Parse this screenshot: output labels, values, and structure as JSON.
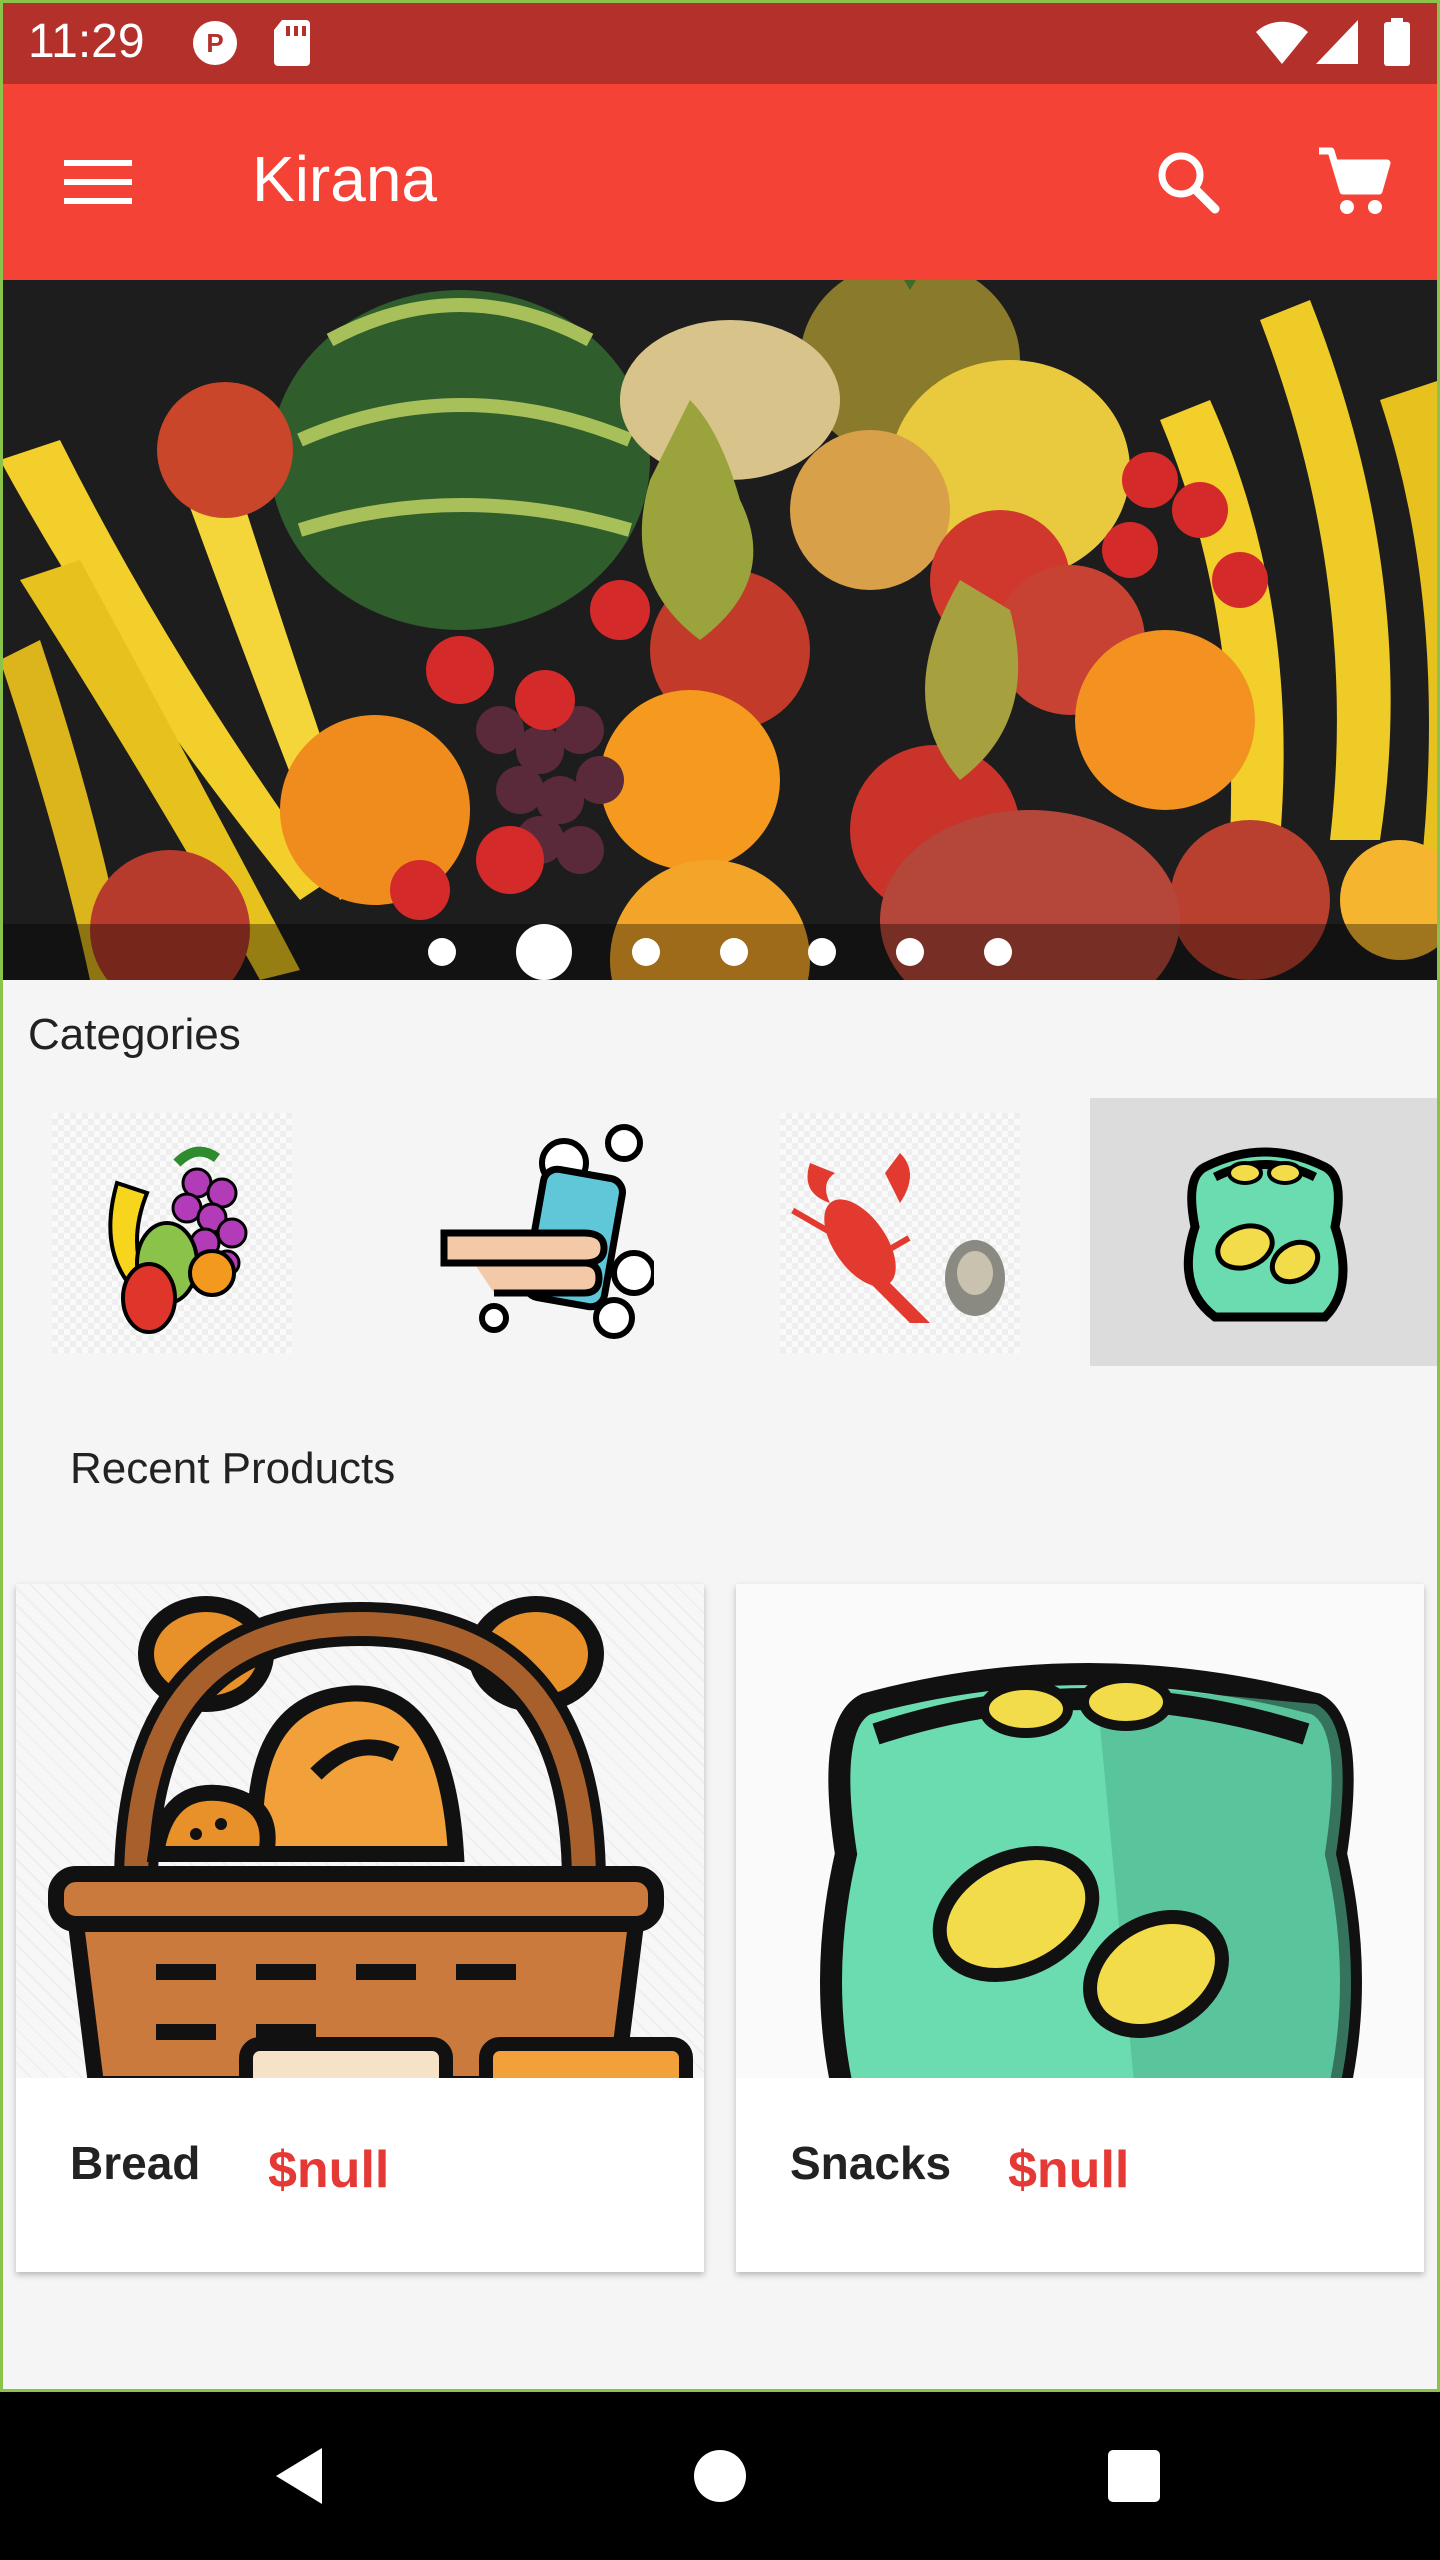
{
  "status_bar": {
    "time": "11:29"
  },
  "app_bar": {
    "title": "Kirana",
    "icons": [
      "menu-icon",
      "search-icon",
      "cart-icon"
    ],
    "color": "#f44336"
  },
  "banner": {
    "slide_count": 7,
    "active_index": 1
  },
  "categories": {
    "title": "Categories",
    "items": [
      {
        "icon": "fruits-icon"
      },
      {
        "icon": "hand-wash-icon"
      },
      {
        "icon": "seafood-icon"
      },
      {
        "icon": "snacks-chips-icon",
        "selected": true
      }
    ]
  },
  "recent_products": {
    "title": "Recent Products",
    "items": [
      {
        "name": "Bread",
        "price": "$null",
        "icon": "bread-basket-icon"
      },
      {
        "name": "Snacks",
        "price": "$null",
        "icon": "chips-bag-icon"
      }
    ]
  },
  "colors": {
    "accent": "#f44336",
    "status_bar": "#b3302b",
    "price": "#e53935"
  }
}
